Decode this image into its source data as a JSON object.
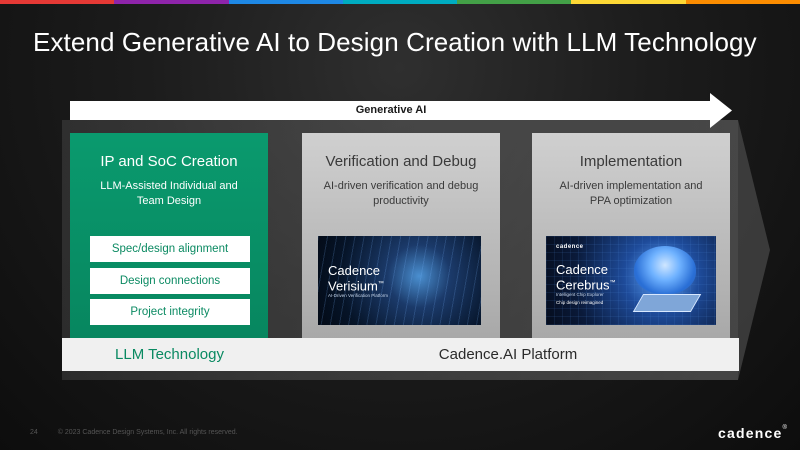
{
  "stripe_colors": [
    "#e53935",
    "#8e24aa",
    "#1e88e5",
    "#00acc1",
    "#43a047",
    "#fdd835",
    "#fb8c00"
  ],
  "slide": {
    "title": "Extend Generative AI to Design Creation with LLM Technology",
    "arrow_label": "Generative AI"
  },
  "columns": [
    {
      "title": "IP and SoC Creation",
      "subtitle": "LLM-Assisted Individual and Team Design",
      "items": [
        "Spec/design alignment",
        "Design connections",
        "Project integrity"
      ]
    },
    {
      "title": "Verification and Debug",
      "subtitle": "AI-driven verification and debug productivity",
      "product": {
        "brand": "Cadence",
        "name": "Verisium",
        "trademark": "™",
        "tagline": "AI-Driven Verification Platform"
      }
    },
    {
      "title": "Implementation",
      "subtitle": "AI-driven implementation and PPA optimization",
      "product": {
        "logo": "cadence",
        "brand": "Cadence",
        "name": "Cerebrus",
        "trademark": "™",
        "tagline": "Intelligent Chip Explorer",
        "slogan": "Chip design reimagined"
      }
    }
  ],
  "platform": {
    "llm_label": "LLM Technology",
    "cadence_ai_label": "Cadence.AI Platform"
  },
  "footer": {
    "page_number": "24",
    "copyright": "© 2023 Cadence Design Systems, Inc. All rights reserved.",
    "brand": "cadence",
    "registered": "®"
  }
}
